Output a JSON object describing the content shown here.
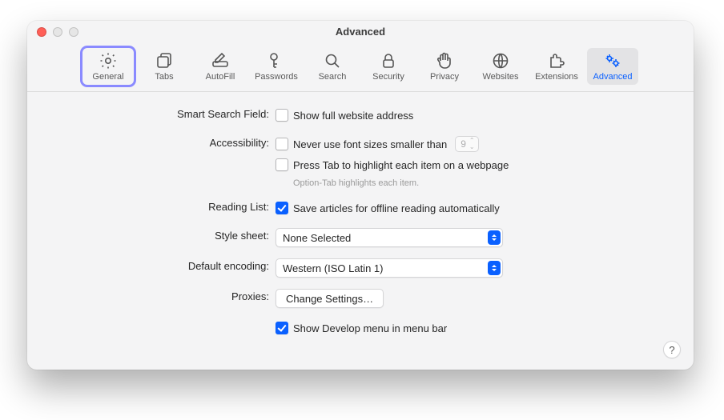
{
  "window": {
    "title": "Advanced"
  },
  "toolbar": {
    "items": [
      {
        "id": "general",
        "label": "General"
      },
      {
        "id": "tabs",
        "label": "Tabs"
      },
      {
        "id": "autofill",
        "label": "AutoFill"
      },
      {
        "id": "passwords",
        "label": "Passwords"
      },
      {
        "id": "search",
        "label": "Search"
      },
      {
        "id": "security",
        "label": "Security"
      },
      {
        "id": "privacy",
        "label": "Privacy"
      },
      {
        "id": "websites",
        "label": "Websites"
      },
      {
        "id": "extensions",
        "label": "Extensions"
      },
      {
        "id": "advanced",
        "label": "Advanced"
      }
    ]
  },
  "sections": {
    "smart_search": {
      "label": "Smart Search Field:",
      "show_full_address": {
        "label": "Show full website address",
        "checked": false
      }
    },
    "accessibility": {
      "label": "Accessibility:",
      "min_font": {
        "label": "Never use font sizes smaller than",
        "checked": false,
        "value": "9"
      },
      "press_tab": {
        "label": "Press Tab to highlight each item on a webpage",
        "checked": false
      },
      "hint": "Option-Tab highlights each item."
    },
    "reading_list": {
      "label": "Reading List:",
      "offline": {
        "label": "Save articles for offline reading automatically",
        "checked": true
      }
    },
    "style_sheet": {
      "label": "Style sheet:",
      "value": "None Selected"
    },
    "encoding": {
      "label": "Default encoding:",
      "value": "Western (ISO Latin 1)"
    },
    "proxies": {
      "label": "Proxies:",
      "button": "Change Settings…"
    },
    "develop": {
      "label": "Show Develop menu in menu bar",
      "checked": true
    }
  },
  "help": "?"
}
